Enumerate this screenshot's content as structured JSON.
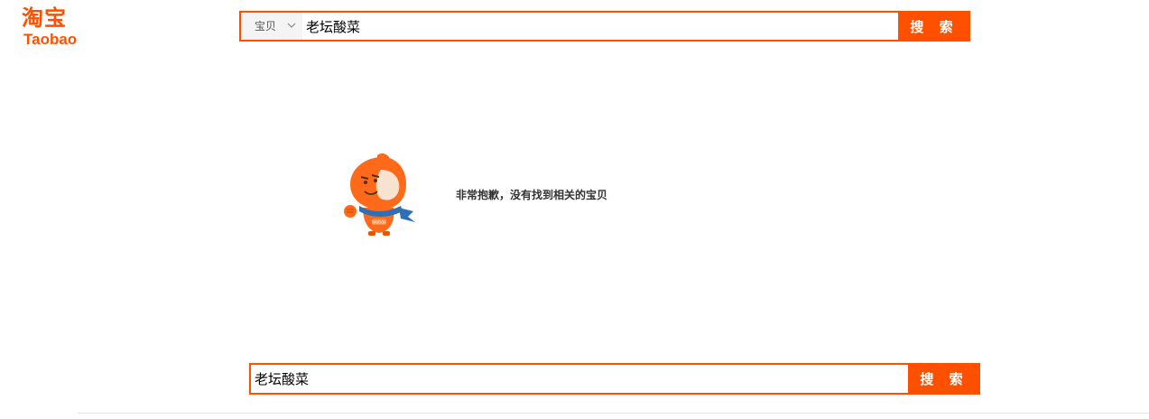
{
  "logo": {
    "cn": "淘宝",
    "en": "Taobao"
  },
  "top_search": {
    "scope": "宝贝",
    "query": "老坛酸菜",
    "button_label": "搜 索"
  },
  "no_result": {
    "message": "非常抱歉，没有找到相关的宝贝",
    "mascot_badge": "taobao"
  },
  "bottom_search": {
    "query": "老坛酸菜",
    "button_label": "搜 索"
  },
  "colors": {
    "brand": "#ff5000",
    "scope_bg": "#f4f4f4",
    "scarf": "#2f6fb5"
  },
  "icons": {
    "scope_dropdown": "chevron-down-icon",
    "mascot": "taobao-mascot-icon"
  }
}
